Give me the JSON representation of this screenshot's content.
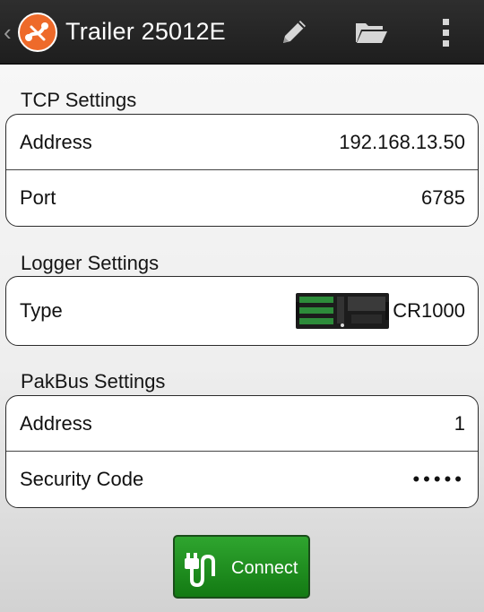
{
  "header": {
    "title": "Trailer 25012E",
    "icons": [
      "back-chevron-icon",
      "app-logo-icon",
      "edit-icon",
      "folder-open-icon",
      "overflow-menu-icon"
    ]
  },
  "tcp": {
    "heading": "TCP Settings",
    "address_label": "Address",
    "address_value": "192.168.13.50",
    "port_label": "Port",
    "port_value": "6785"
  },
  "logger": {
    "heading": "Logger Settings",
    "type_label": "Type",
    "type_value": "CR1000"
  },
  "pakbus": {
    "heading": "PakBus Settings",
    "address_label": "Address",
    "address_value": "1",
    "security_label": "Security Code",
    "security_value": "•••••"
  },
  "connect": {
    "label": "Connect"
  },
  "colors": {
    "actionbar": "#252525",
    "accent": "#ee6a2a",
    "connect": "#1f8f1f"
  }
}
